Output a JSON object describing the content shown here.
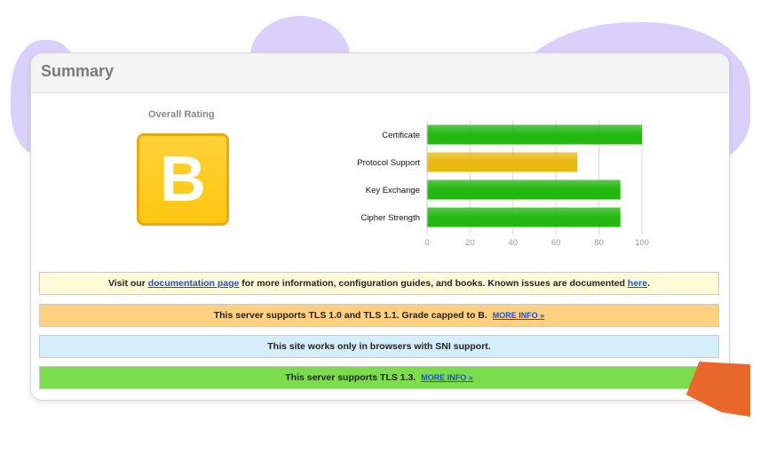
{
  "summary": {
    "title": "Summary",
    "overall_rating_label": "Overall Rating",
    "grade": "B",
    "grade_color": "#ffc610"
  },
  "chart_data": {
    "type": "bar",
    "orientation": "horizontal",
    "categories": [
      "Certificate",
      "Protocol Support",
      "Key Exchange",
      "Cipher Strength"
    ],
    "values": [
      100,
      70,
      90,
      90
    ],
    "bar_colors": [
      "#22b80f",
      "#e8b90f",
      "#22b80f",
      "#22b80f"
    ],
    "xlim": [
      0,
      100
    ],
    "x_ticks": [
      0,
      20,
      40,
      60,
      80,
      100
    ],
    "grid": true
  },
  "messages": {
    "docs": {
      "prefix": "Visit our ",
      "link1": "documentation page",
      "middle": " for more information, configuration guides, and books. Known issues are documented ",
      "link2": "here",
      "suffix": "."
    },
    "tls_old": {
      "text": "This server supports TLS 1.0 and TLS 1.1. Grade capped to B.",
      "link": "MORE INFO »"
    },
    "sni": {
      "text": "This site works only in browsers with SNI support."
    },
    "tls13": {
      "text": "This server supports TLS 1.3.",
      "link": "MORE INFO »"
    }
  },
  "colors": {
    "accent_green": "#22b80f",
    "accent_yellow": "#e8b90f",
    "notice_yellow": "#fffbd8",
    "notice_orange": "#ffd080",
    "notice_blue": "#d4eefc",
    "notice_green": "#7ddc4b",
    "link_blue": "#1a4fd8"
  }
}
